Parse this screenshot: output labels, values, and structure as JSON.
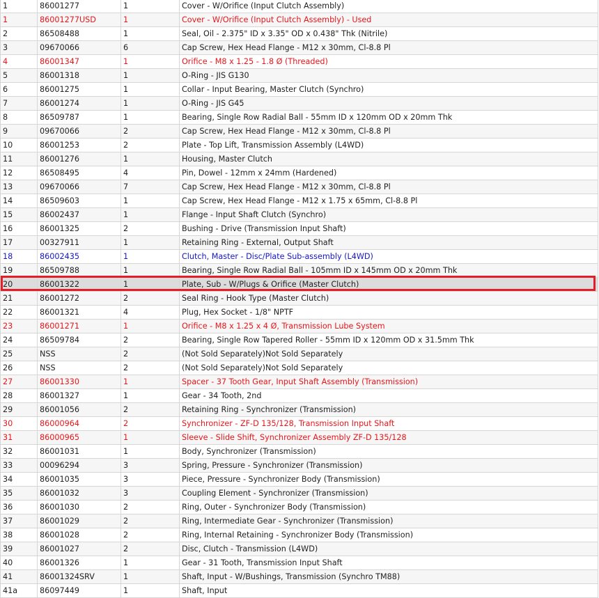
{
  "colors": {
    "red": "#e8161b",
    "blue": "#1616c8",
    "highlight": "#e41e26",
    "selected_bg": "#dcdcdc"
  },
  "parts": [
    {
      "num": "1",
      "part": "86001277",
      "qty": "1",
      "desc": "Cover - W/Orifice (Input Clutch Assembly)",
      "style": ""
    },
    {
      "num": "1",
      "part": "86001277USD",
      "qty": "1",
      "desc": "Cover - W/Orifice (Input Clutch Assembly) - Used",
      "style": "red"
    },
    {
      "num": "2",
      "part": "86508488",
      "qty": "1",
      "desc": "Seal, Oil - 2.375\" ID x 3.35\" OD x 0.438\" Thk (Nitrile)",
      "style": ""
    },
    {
      "num": "3",
      "part": "09670066",
      "qty": "6",
      "desc": "Cap Screw, Hex Head Flange - M12 x 30mm, Cl-8.8 Pl",
      "style": ""
    },
    {
      "num": "4",
      "part": "86001347",
      "qty": "1",
      "desc": "Orifice - M8 x 1.25 - 1.8 Ø (Threaded)",
      "style": "red"
    },
    {
      "num": "5",
      "part": "86001318",
      "qty": "1",
      "desc": "O-Ring - JIS G130",
      "style": ""
    },
    {
      "num": "6",
      "part": "86001275",
      "qty": "1",
      "desc": "Collar - Input Bearing, Master Clutch (Synchro)",
      "style": ""
    },
    {
      "num": "7",
      "part": "86001274",
      "qty": "1",
      "desc": "O-Ring - JIS G45",
      "style": ""
    },
    {
      "num": "8",
      "part": "86509787",
      "qty": "1",
      "desc": "Bearing, Single Row Radial Ball - 55mm ID x 120mm OD x 20mm Thk",
      "style": ""
    },
    {
      "num": "9",
      "part": "09670066",
      "qty": "2",
      "desc": "Cap Screw, Hex Head Flange - M12 x 30mm, Cl-8.8 Pl",
      "style": ""
    },
    {
      "num": "10",
      "part": "86001253",
      "qty": "2",
      "desc": "Plate - Top Lift, Transmission Assembly (L4WD)",
      "style": ""
    },
    {
      "num": "11",
      "part": "86001276",
      "qty": "1",
      "desc": "Housing, Master Clutch",
      "style": ""
    },
    {
      "num": "12",
      "part": "86508495",
      "qty": "4",
      "desc": "Pin, Dowel - 12mm x 24mm (Hardened)",
      "style": ""
    },
    {
      "num": "13",
      "part": "09670066",
      "qty": "7",
      "desc": "Cap Screw, Hex Head Flange - M12 x 30mm, Cl-8.8 Pl",
      "style": ""
    },
    {
      "num": "14",
      "part": "86509603",
      "qty": "1",
      "desc": "Cap Screw, Hex Head Flange - M12 x 1.75 x 65mm, Cl-8.8 Pl",
      "style": ""
    },
    {
      "num": "15",
      "part": "86002437",
      "qty": "1",
      "desc": "Flange - Input Shaft Clutch (Synchro)",
      "style": ""
    },
    {
      "num": "16",
      "part": "86001325",
      "qty": "2",
      "desc": "Bushing - Drive (Transmission Input Shaft)",
      "style": ""
    },
    {
      "num": "17",
      "part": "00327911",
      "qty": "1",
      "desc": "Retaining Ring - External, Output Shaft",
      "style": ""
    },
    {
      "num": "18",
      "part": "86002435",
      "qty": "1",
      "desc": "Clutch, Master - Disc/Plate Sub-assembly (L4WD)",
      "style": "blue"
    },
    {
      "num": "19",
      "part": "86509788",
      "qty": "1",
      "desc": "Bearing, Single Row Radial Ball - 105mm ID x 145mm OD x 20mm Thk",
      "style": ""
    },
    {
      "num": "20",
      "part": "86001322",
      "qty": "1",
      "desc": "Plate, Sub - W/Plugs & Orifice (Master Clutch)",
      "style": "selected"
    },
    {
      "num": "21",
      "part": "86001272",
      "qty": "2",
      "desc": "Seal Ring - Hook Type (Master Clutch)",
      "style": ""
    },
    {
      "num": "22",
      "part": "86001321",
      "qty": "4",
      "desc": "Plug, Hex Socket - 1/8\" NPTF",
      "style": ""
    },
    {
      "num": "23",
      "part": "86001271",
      "qty": "1",
      "desc": "Orifice - M8 x 1.25 x 4 Ø, Transmission Lube System",
      "style": "red"
    },
    {
      "num": "24",
      "part": "86509784",
      "qty": "2",
      "desc": "Bearing, Single Row Tapered Roller - 55mm ID x 120mm OD x 31.5mm Thk",
      "style": ""
    },
    {
      "num": "25",
      "part": "NSS",
      "qty": "2",
      "desc": "(Not Sold Separately)Not Sold Separately",
      "style": ""
    },
    {
      "num": "26",
      "part": "NSS",
      "qty": "2",
      "desc": "(Not Sold Separately)Not Sold Separately",
      "style": ""
    },
    {
      "num": "27",
      "part": "86001330",
      "qty": "1",
      "desc": "Spacer - 37 Tooth Gear, Input Shaft Assembly (Transmission)",
      "style": "red"
    },
    {
      "num": "28",
      "part": "86001327",
      "qty": "1",
      "desc": "Gear - 34 Tooth, 2nd",
      "style": ""
    },
    {
      "num": "29",
      "part": "86001056",
      "qty": "2",
      "desc": "Retaining Ring - Synchronizer (Transmission)",
      "style": ""
    },
    {
      "num": "30",
      "part": "86000964",
      "qty": "2",
      "desc": "Synchronizer - ZF-D 135/128, Transmission Input Shaft",
      "style": "red"
    },
    {
      "num": "31",
      "part": "86000965",
      "qty": "1",
      "desc": "Sleeve - Slide Shift, Synchronizer Assembly ZF-D 135/128",
      "style": "red"
    },
    {
      "num": "32",
      "part": "86001031",
      "qty": "1",
      "desc": "Body, Synchronizer (Transmission)",
      "style": ""
    },
    {
      "num": "33",
      "part": "00096294",
      "qty": "3",
      "desc": "Spring, Pressure - Synchronizer (Transmission)",
      "style": ""
    },
    {
      "num": "34",
      "part": "86001035",
      "qty": "3",
      "desc": "Piece, Pressure - Synchronizer Body (Transmission)",
      "style": ""
    },
    {
      "num": "35",
      "part": "86001032",
      "qty": "3",
      "desc": "Coupling Element - Synchronizer (Transmission)",
      "style": ""
    },
    {
      "num": "36",
      "part": "86001030",
      "qty": "2",
      "desc": "Ring, Outer - Synchronizer Body (Transmission)",
      "style": ""
    },
    {
      "num": "37",
      "part": "86001029",
      "qty": "2",
      "desc": "Ring, Intermediate Gear - Synchronizer (Transmission)",
      "style": ""
    },
    {
      "num": "38",
      "part": "86001028",
      "qty": "2",
      "desc": "Ring, Internal Retaining - Synchronizer Body (Transmission)",
      "style": ""
    },
    {
      "num": "39",
      "part": "86001027",
      "qty": "2",
      "desc": "Disc, Clutch - Transmission (L4WD)",
      "style": ""
    },
    {
      "num": "40",
      "part": "86001326",
      "qty": "1",
      "desc": "Gear - 31 Tooth, Transmission Input Shaft",
      "style": ""
    },
    {
      "num": "41",
      "part": "86001324SRV",
      "qty": "1",
      "desc": "Shaft, Input - W/Bushings, Transmission (Synchro TM88)",
      "style": ""
    },
    {
      "num": "41a",
      "part": "86097449",
      "qty": "1",
      "desc": "Shaft, Input",
      "style": ""
    }
  ]
}
